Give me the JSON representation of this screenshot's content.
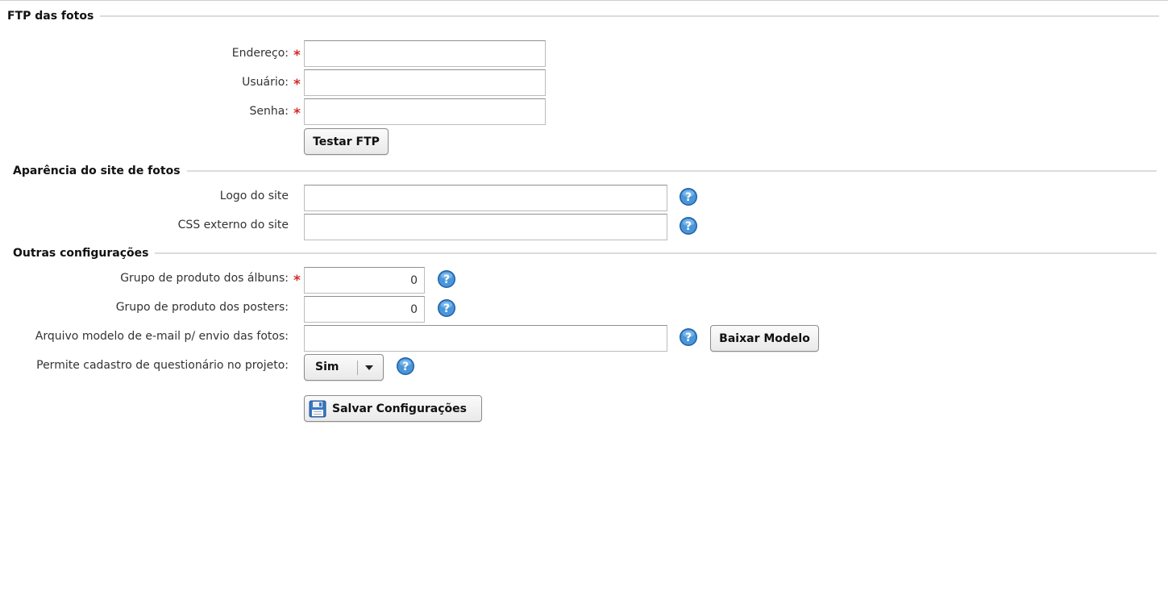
{
  "sections": {
    "ftp": {
      "title": "FTP das fotos"
    },
    "appearance": {
      "title": "Aparência do site de fotos"
    },
    "other": {
      "title": "Outras configurações"
    }
  },
  "ftp": {
    "address_label": "Endereço:",
    "address_value": "",
    "user_label": "Usuário:",
    "user_value": "",
    "password_label": "Senha:",
    "password_value": "",
    "test_button": "Testar FTP"
  },
  "appearance": {
    "logo_label": "Logo do site",
    "logo_value": "",
    "css_label": "CSS externo do site",
    "css_value": ""
  },
  "other": {
    "album_group_label": "Grupo de produto dos álbuns:",
    "album_group_value": "0",
    "poster_group_label": "Grupo de produto dos posters:",
    "poster_group_value": "0",
    "email_template_label": "Arquivo modelo de e-mail p/ envio das fotos:",
    "email_template_value": "",
    "download_template_button": "Baixar Modelo",
    "questionnaire_label": "Permite cadastro de questionário no projeto:",
    "questionnaire_value": "Sim"
  },
  "save_button": "Salvar Configurações",
  "required_marker": "*",
  "icons": {
    "help": "help-icon",
    "save": "floppy-disk-icon",
    "dropdown": "triangle-down-icon"
  },
  "colors": {
    "required": "#d42a2a",
    "help_blue": "#2f7fc6",
    "section_line": "#dcdcdc"
  }
}
